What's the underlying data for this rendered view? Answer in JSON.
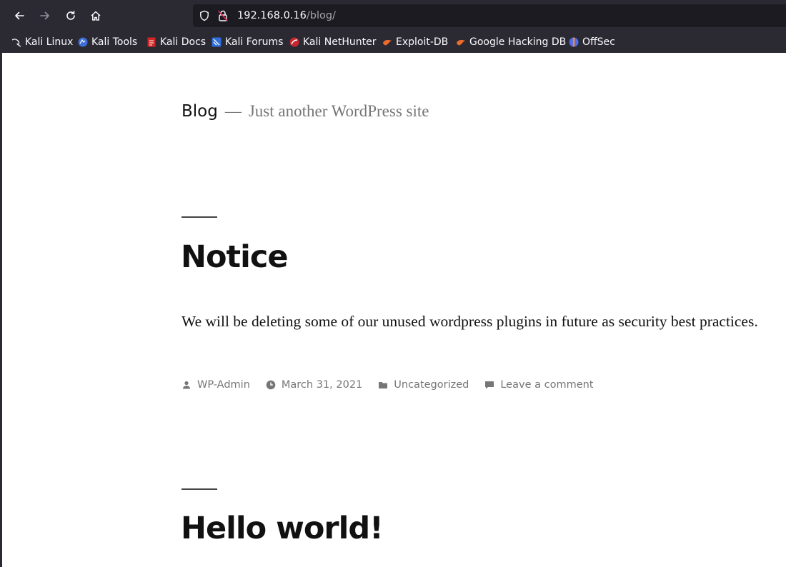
{
  "browser": {
    "url_host": "192.168.0.16",
    "url_path": "/blog/",
    "bookmarks": [
      {
        "label": "Kali Linux",
        "icon": "kali-dragon-icon"
      },
      {
        "label": "Kali Tools",
        "icon": "kali-tools-icon"
      },
      {
        "label": "Kali Docs",
        "icon": "kali-docs-icon"
      },
      {
        "label": "Kali Forums",
        "icon": "kali-forums-icon"
      },
      {
        "label": "Kali NetHunter",
        "icon": "kali-nethunter-icon"
      },
      {
        "label": "Exploit-DB",
        "icon": "exploit-db-icon"
      },
      {
        "label": "Google Hacking DB",
        "icon": "ghdb-icon"
      },
      {
        "label": "OffSec",
        "icon": "offsec-icon"
      }
    ]
  },
  "site": {
    "name": "Blog",
    "separator": "—",
    "description": "Just another WordPress site"
  },
  "posts": [
    {
      "title": "Notice",
      "body": "We will be deleting some of our unused wordpress plugins in future as security best practices.",
      "author": "WP-Admin",
      "date": "March 31, 2021",
      "category": "Uncategorized",
      "comment_link": "Leave a comment"
    },
    {
      "title": "Hello world!"
    }
  ],
  "colors": {
    "chrome_bg": "#2b2a33",
    "urlbar_bg": "#1c1b22",
    "meta_text": "#767676",
    "title_text": "#111111"
  }
}
